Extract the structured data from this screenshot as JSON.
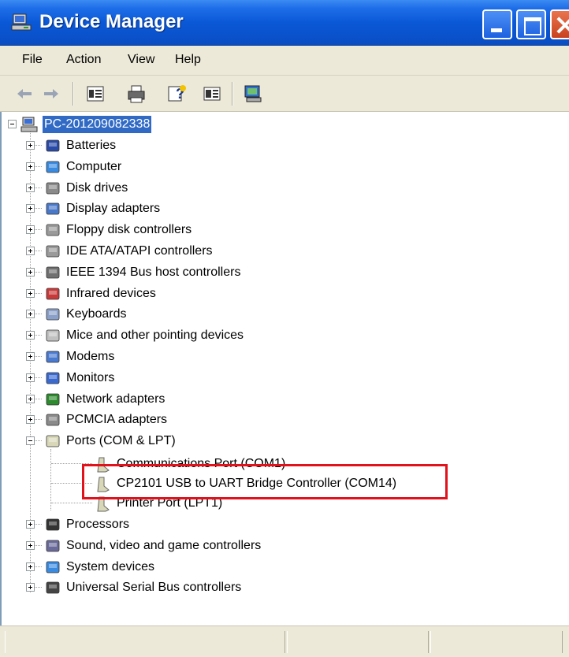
{
  "window": {
    "title": "Device Manager",
    "accent": "#0a58d6"
  },
  "menu": [
    "File",
    "Action",
    "View",
    "Help"
  ],
  "toolbar": {
    "buttons": [
      "back-arrow-icon",
      "forward-arrow-icon",
      "properties-icon",
      "print-icon",
      "help-icon",
      "view-icon",
      "scan-hardware-icon"
    ]
  },
  "tree": {
    "root": "PC-201209082338",
    "categories": [
      {
        "label": "Batteries",
        "icon": "battery-icon"
      },
      {
        "label": "Computer",
        "icon": "computer-icon"
      },
      {
        "label": "Disk drives",
        "icon": "disk-drive-icon"
      },
      {
        "label": "Display adapters",
        "icon": "display-adapter-icon"
      },
      {
        "label": "Floppy disk controllers",
        "icon": "floppy-controller-icon"
      },
      {
        "label": "IDE ATA/ATAPI controllers",
        "icon": "ide-controller-icon"
      },
      {
        "label": "IEEE 1394 Bus host controllers",
        "icon": "ieee1394-icon"
      },
      {
        "label": "Infrared devices",
        "icon": "infrared-icon"
      },
      {
        "label": "Keyboards",
        "icon": "keyboard-icon"
      },
      {
        "label": "Mice and other pointing devices",
        "icon": "mouse-icon"
      },
      {
        "label": "Modems",
        "icon": "modem-icon"
      },
      {
        "label": "Monitors",
        "icon": "monitor-icon"
      },
      {
        "label": "Network adapters",
        "icon": "network-adapter-icon"
      },
      {
        "label": "PCMCIA adapters",
        "icon": "pcmcia-icon"
      },
      {
        "label": "Ports (COM & LPT)",
        "icon": "port-icon",
        "expanded": true
      },
      {
        "label": "Processors",
        "icon": "processor-icon"
      },
      {
        "label": "Sound, video and game controllers",
        "icon": "sound-icon"
      },
      {
        "label": "System devices",
        "icon": "system-devices-icon"
      },
      {
        "label": "Universal Serial Bus controllers",
        "icon": "usb-icon"
      }
    ],
    "ports_children": [
      "Communications Port (COM1)",
      "CP2101 USB to UART Bridge Controller (COM14)",
      "Printer Port (LPT1)"
    ]
  },
  "highlight_color": "#e1121b"
}
